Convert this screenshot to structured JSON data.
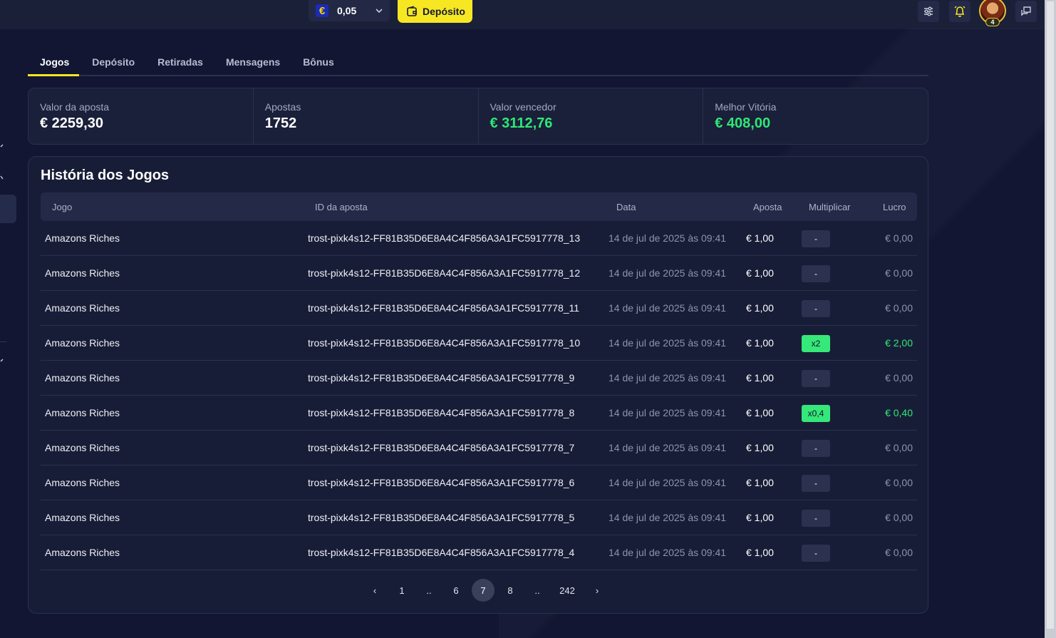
{
  "header": {
    "currency_symbol": "€",
    "balance": "0,05",
    "deposit_label": "Depósito",
    "avatar_level": "4"
  },
  "tabs": [
    {
      "label": "Jogos",
      "active": true
    },
    {
      "label": "Depósito",
      "active": false
    },
    {
      "label": "Retiradas",
      "active": false
    },
    {
      "label": "Mensagens",
      "active": false
    },
    {
      "label": "Bônus",
      "active": false
    }
  ],
  "stats": [
    {
      "label": "Valor da aposta",
      "value": "€ 2259,30",
      "highlight": false
    },
    {
      "label": "Apostas",
      "value": "1752",
      "highlight": false
    },
    {
      "label": "Valor vencedor",
      "value": "€ 3112,76",
      "highlight": true
    },
    {
      "label": "Melhor Vitória",
      "value": "€ 408,00",
      "highlight": true
    }
  ],
  "history": {
    "title": "História dos Jogos",
    "columns": {
      "game": "Jogo",
      "bet_id": "ID da aposta",
      "date": "Data",
      "bet": "Aposta",
      "multiplier": "Multiplicar",
      "profit": "Lucro"
    },
    "rows": [
      {
        "game": "Amazons Riches",
        "bet_id": "trost-pixk4s12-FF81B35D6E8A4C4F856A3A1FC5917778_13",
        "date": "14 de jul de 2025 às 09:41",
        "bet": "€ 1,00",
        "multiplier": "-",
        "win": false,
        "profit": "€ 0,00"
      },
      {
        "game": "Amazons Riches",
        "bet_id": "trost-pixk4s12-FF81B35D6E8A4C4F856A3A1FC5917778_12",
        "date": "14 de jul de 2025 às 09:41",
        "bet": "€ 1,00",
        "multiplier": "-",
        "win": false,
        "profit": "€ 0,00"
      },
      {
        "game": "Amazons Riches",
        "bet_id": "trost-pixk4s12-FF81B35D6E8A4C4F856A3A1FC5917778_11",
        "date": "14 de jul de 2025 às 09:41",
        "bet": "€ 1,00",
        "multiplier": "-",
        "win": false,
        "profit": "€ 0,00"
      },
      {
        "game": "Amazons Riches",
        "bet_id": "trost-pixk4s12-FF81B35D6E8A4C4F856A3A1FC5917778_10",
        "date": "14 de jul de 2025 às 09:41",
        "bet": "€ 1,00",
        "multiplier": "x2",
        "win": true,
        "profit": "€ 2,00"
      },
      {
        "game": "Amazons Riches",
        "bet_id": "trost-pixk4s12-FF81B35D6E8A4C4F856A3A1FC5917778_9",
        "date": "14 de jul de 2025 às 09:41",
        "bet": "€ 1,00",
        "multiplier": "-",
        "win": false,
        "profit": "€ 0,00"
      },
      {
        "game": "Amazons Riches",
        "bet_id": "trost-pixk4s12-FF81B35D6E8A4C4F856A3A1FC5917778_8",
        "date": "14 de jul de 2025 às 09:41",
        "bet": "€ 1,00",
        "multiplier": "x0,4",
        "win": true,
        "profit": "€ 0,40"
      },
      {
        "game": "Amazons Riches",
        "bet_id": "trost-pixk4s12-FF81B35D6E8A4C4F856A3A1FC5917778_7",
        "date": "14 de jul de 2025 às 09:41",
        "bet": "€ 1,00",
        "multiplier": "-",
        "win": false,
        "profit": "€ 0,00"
      },
      {
        "game": "Amazons Riches",
        "bet_id": "trost-pixk4s12-FF81B35D6E8A4C4F856A3A1FC5917778_6",
        "date": "14 de jul de 2025 às 09:41",
        "bet": "€ 1,00",
        "multiplier": "-",
        "win": false,
        "profit": "€ 0,00"
      },
      {
        "game": "Amazons Riches",
        "bet_id": "trost-pixk4s12-FF81B35D6E8A4C4F856A3A1FC5917778_5",
        "date": "14 de jul de 2025 às 09:41",
        "bet": "€ 1,00",
        "multiplier": "-",
        "win": false,
        "profit": "€ 0,00"
      },
      {
        "game": "Amazons Riches",
        "bet_id": "trost-pixk4s12-FF81B35D6E8A4C4F856A3A1FC5917778_4",
        "date": "14 de jul de 2025 às 09:41",
        "bet": "€ 1,00",
        "multiplier": "-",
        "win": false,
        "profit": "€ 0,00"
      }
    ]
  },
  "pagination": {
    "items": [
      {
        "label": "‹",
        "kind": "prev"
      },
      {
        "label": "1",
        "kind": "page"
      },
      {
        "label": "..",
        "kind": "ellipsis"
      },
      {
        "label": "6",
        "kind": "page"
      },
      {
        "label": "7",
        "kind": "current"
      },
      {
        "label": "8",
        "kind": "page"
      },
      {
        "label": "..",
        "kind": "ellipsis"
      },
      {
        "label": "242",
        "kind": "page"
      },
      {
        "label": "›",
        "kind": "next"
      }
    ]
  },
  "colors": {
    "accent_yellow": "#f6e722",
    "win_green": "#2ee875",
    "background": "#121632"
  }
}
